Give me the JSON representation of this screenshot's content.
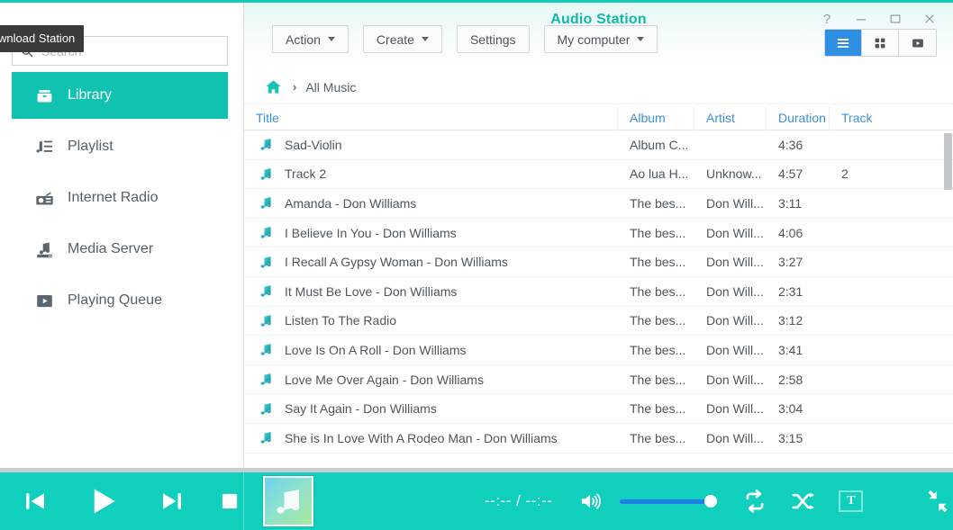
{
  "window": {
    "title": "Audio Station",
    "app_icon": "music-note-icon",
    "controls": {
      "help": "?",
      "minimize": "minimize-icon",
      "maximize": "maximize-icon",
      "close": "close-icon"
    }
  },
  "tooltip": {
    "text": "wnload Station"
  },
  "sidebar": {
    "search": {
      "value": "",
      "placeholder": "Search"
    },
    "items": [
      {
        "label": "Library",
        "icon": "library-icon",
        "active": true
      },
      {
        "label": "Playlist",
        "icon": "playlist-icon",
        "active": false
      },
      {
        "label": "Internet Radio",
        "icon": "radio-icon",
        "active": false
      },
      {
        "label": "Media Server",
        "icon": "media-server-icon",
        "active": false
      },
      {
        "label": "Playing Queue",
        "icon": "playing-queue-icon",
        "active": false
      }
    ]
  },
  "toolbar": {
    "buttons": [
      {
        "label": "Action",
        "has_caret": true
      },
      {
        "label": "Create",
        "has_caret": true
      },
      {
        "label": "Settings",
        "has_caret": false
      },
      {
        "label": "My computer",
        "has_caret": true
      }
    ],
    "views": [
      {
        "name": "list-view",
        "icon": "list-icon",
        "active": true
      },
      {
        "name": "grid-view",
        "icon": "grid-icon",
        "active": false
      },
      {
        "name": "play-view",
        "icon": "play-box-icon",
        "active": false
      }
    ]
  },
  "breadcrumb": {
    "home_icon": "home-icon",
    "separator": "›",
    "current": "All Music"
  },
  "table": {
    "columns": [
      "Title",
      "Album",
      "Artist",
      "Duration",
      "Track"
    ],
    "sorted_column": "Title",
    "rows": [
      {
        "title": "Sad-Violin",
        "album": "Album C...",
        "artist": "",
        "duration": "4:36",
        "track": ""
      },
      {
        "title": "Track 2",
        "album": "Ao lua H...",
        "artist": "Unknow...",
        "duration": "4:57",
        "track": "2"
      },
      {
        "title": "Amanda - Don Williams",
        "album": "The bes...",
        "artist": "Don Will...",
        "duration": "3:11",
        "track": ""
      },
      {
        "title": "I Believe In You - Don Williams",
        "album": "The bes...",
        "artist": "Don Will...",
        "duration": "4:06",
        "track": ""
      },
      {
        "title": "I Recall A Gypsy Woman - Don Williams",
        "album": "The bes...",
        "artist": "Don Will...",
        "duration": "3:27",
        "track": ""
      },
      {
        "title": "It Must Be Love - Don Williams",
        "album": "The bes...",
        "artist": "Don Will...",
        "duration": "2:31",
        "track": ""
      },
      {
        "title": "Listen To The Radio",
        "album": "The bes...",
        "artist": "Don Will...",
        "duration": "3:12",
        "track": ""
      },
      {
        "title": "Love Is On A Roll - Don Williams",
        "album": "The bes...",
        "artist": "Don Will...",
        "duration": "3:41",
        "track": ""
      },
      {
        "title": "Love Me Over Again - Don Williams",
        "album": "The bes...",
        "artist": "Don Will...",
        "duration": "2:58",
        "track": ""
      },
      {
        "title": "Say It Again - Don Williams",
        "album": "The bes...",
        "artist": "Don Will...",
        "duration": "3:04",
        "track": ""
      },
      {
        "title": "She is In Love With A Rodeo Man - Don Williams",
        "album": "The bes...",
        "artist": "Don Will...",
        "duration": "3:15",
        "track": ""
      },
      {
        "title": "",
        "album": "",
        "artist": "",
        "duration": "",
        "track": ""
      }
    ]
  },
  "player": {
    "transport": [
      {
        "name": "previous-button",
        "icon": "previous-icon"
      },
      {
        "name": "play-button",
        "icon": "play-icon"
      },
      {
        "name": "next-button",
        "icon": "next-icon"
      },
      {
        "name": "stop-button",
        "icon": "stop-icon"
      }
    ],
    "album_art_icon": "music-note-icon",
    "time_elapsed": "--:--",
    "time_separator": "/",
    "time_total": "--:--",
    "time_display": "--:-- / --:--",
    "volume_icon": "volume-icon",
    "volume_percent": 100,
    "repeat_icon": "repeat-icon",
    "shuffle_icon": "shuffle-icon",
    "lyrics_label": "T",
    "collapse_icon": "collapse-icon"
  },
  "colors": {
    "accent_teal": "#10c2b0",
    "player_teal": "#10cfbc",
    "title_teal": "#12b9a8",
    "header_blue": "#3f8fd8",
    "active_view_blue": "#2f8fe3",
    "volume_blue": "#1f7fe8",
    "app_icon_green": "#7ed321"
  }
}
